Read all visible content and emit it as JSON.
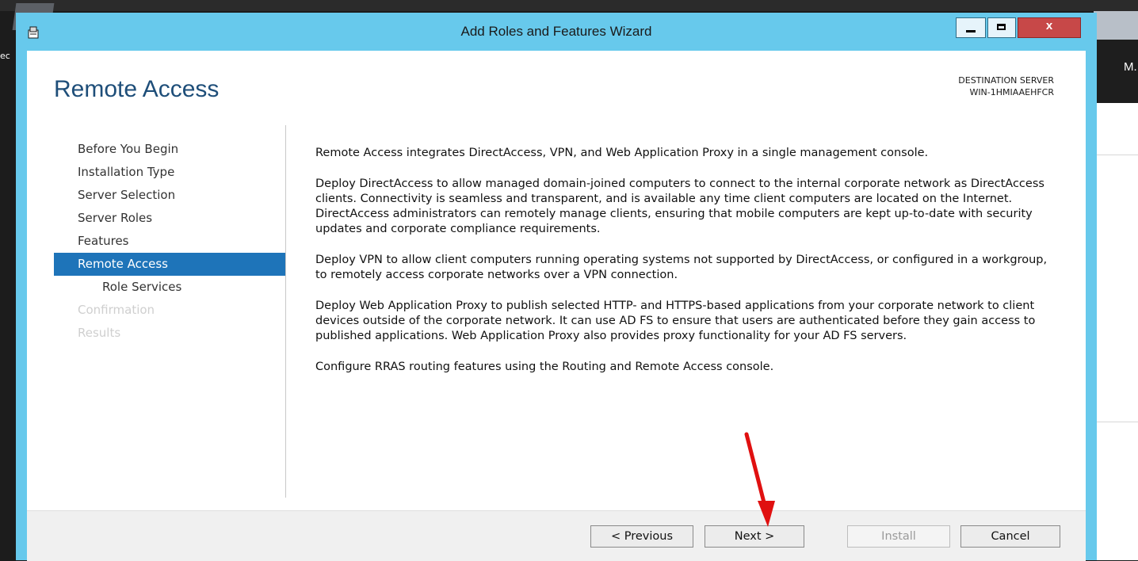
{
  "background": {
    "left_text": "ec",
    "right_text": "M."
  },
  "window": {
    "title": "Add Roles and Features Wizard",
    "controls": {
      "minimize": "minimize",
      "maximize": "maximize",
      "close": "x"
    }
  },
  "page": {
    "title": "Remote Access",
    "destination_label": "DESTINATION SERVER",
    "destination_value": "WIN-1HMIAAEHFCR"
  },
  "nav": {
    "items": [
      {
        "label": "Before You Begin",
        "state": "normal"
      },
      {
        "label": "Installation Type",
        "state": "normal"
      },
      {
        "label": "Server Selection",
        "state": "normal"
      },
      {
        "label": "Server Roles",
        "state": "normal"
      },
      {
        "label": "Features",
        "state": "normal"
      },
      {
        "label": "Remote Access",
        "state": "active"
      },
      {
        "label": "Role Services",
        "state": "sub"
      },
      {
        "label": "Confirmation",
        "state": "disabled"
      },
      {
        "label": "Results",
        "state": "disabled"
      }
    ]
  },
  "content": {
    "paragraphs": [
      "Remote Access integrates DirectAccess, VPN, and Web Application Proxy in a single management console.",
      "Deploy DirectAccess to allow managed domain-joined computers to connect to the internal corporate network as DirectAccess clients. Connectivity is seamless and transparent, and is available any time client computers are located on the Internet. DirectAccess administrators can remotely manage clients, ensuring that mobile computers are kept up-to-date with security updates and corporate compliance requirements.",
      "Deploy VPN to allow client computers running operating systems not supported by DirectAccess, or configured in a workgroup, to remotely access corporate networks over a VPN connection.",
      "Deploy Web Application Proxy to publish selected HTTP- and HTTPS-based applications from your corporate network to client devices outside of the corporate network. It can use AD FS to ensure that users are authenticated before they gain access to published applications. Web Application Proxy also provides proxy functionality for your AD FS servers.",
      "Configure RRAS routing features using the Routing and Remote Access console."
    ]
  },
  "footer": {
    "previous": "< Previous",
    "next": "Next >",
    "install": "Install",
    "cancel": "Cancel"
  },
  "colors": {
    "title_bar": "#67c9ec",
    "active_nav": "#1e74b9",
    "page_title": "#1e4e79",
    "annotation_arrow": "#e01010"
  }
}
